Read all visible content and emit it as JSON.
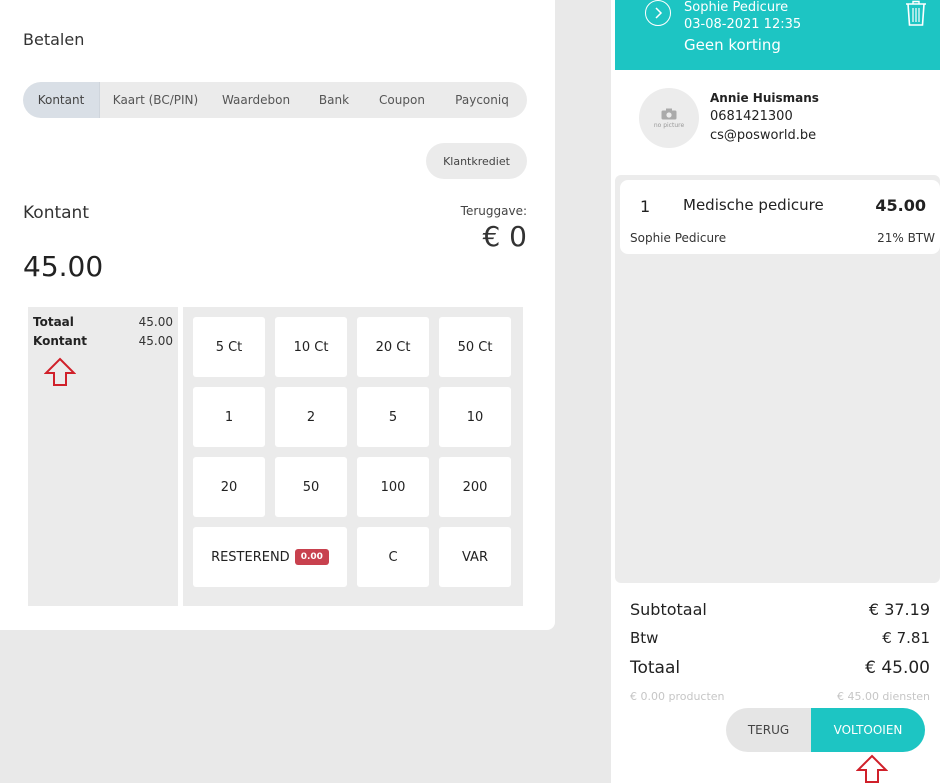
{
  "payment": {
    "title": "Betalen",
    "tabs": [
      {
        "label": "Kontant"
      },
      {
        "label": "Kaart (BC/PIN)"
      },
      {
        "label": "Waardebon"
      },
      {
        "label": "Bank"
      },
      {
        "label": "Coupon"
      },
      {
        "label": "Payconiq"
      }
    ],
    "active_tab": "Kontant",
    "credit_button": "Klantkrediet",
    "method_label": "Kontant",
    "amount": "45.00",
    "change_label": "Teruggave:",
    "change_value": "€ 0",
    "summary": [
      {
        "label": "Totaal",
        "value": "45.00"
      },
      {
        "label": "Kontant",
        "value": "45.00"
      }
    ],
    "keypad": [
      {
        "label": "5 Ct"
      },
      {
        "label": "10 Ct"
      },
      {
        "label": "20 Ct"
      },
      {
        "label": "50 Ct"
      },
      {
        "label": "1"
      },
      {
        "label": "2"
      },
      {
        "label": "5"
      },
      {
        "label": "10"
      },
      {
        "label": "20"
      },
      {
        "label": "50"
      },
      {
        "label": "100"
      },
      {
        "label": "200"
      }
    ],
    "remaining": {
      "label": "RESTEREND",
      "badge": "0.00"
    },
    "clear_key": "C",
    "var_key": "VAR"
  },
  "order": {
    "header": {
      "staff": "Sophie Pedicure",
      "datetime": "03-08-2021 12:35",
      "discount": "Geen korting"
    },
    "customer": {
      "avatar_text": "no picture",
      "name": "Annie Huismans",
      "phone": "0681421300",
      "email": "cs@posworld.be"
    },
    "line": {
      "qty": "1",
      "description": "Medische pedicure",
      "price": "45.00",
      "staff": "Sophie Pedicure",
      "vat": "21% BTW"
    },
    "totals": {
      "subtotal_label": "Subtotaal",
      "subtotal_value": "€ 37.19",
      "vat_label": "Btw",
      "vat_value": "€ 7.81",
      "total_label": "Totaal",
      "total_value": "€ 45.00",
      "products_label": "€ 0.00 producten",
      "services_label": "€ 45.00 diensten"
    },
    "back_button": "TERUG",
    "complete_button": "VOLTOOIEN"
  },
  "colors": {
    "accent": "#1dc5c3",
    "badge": "#c8414e",
    "annotation_arrow": "#d0202a"
  },
  "icons": [
    "chevron-right-icon",
    "trash-icon",
    "camera-icon",
    "arrow-up-annotation-icon"
  ]
}
